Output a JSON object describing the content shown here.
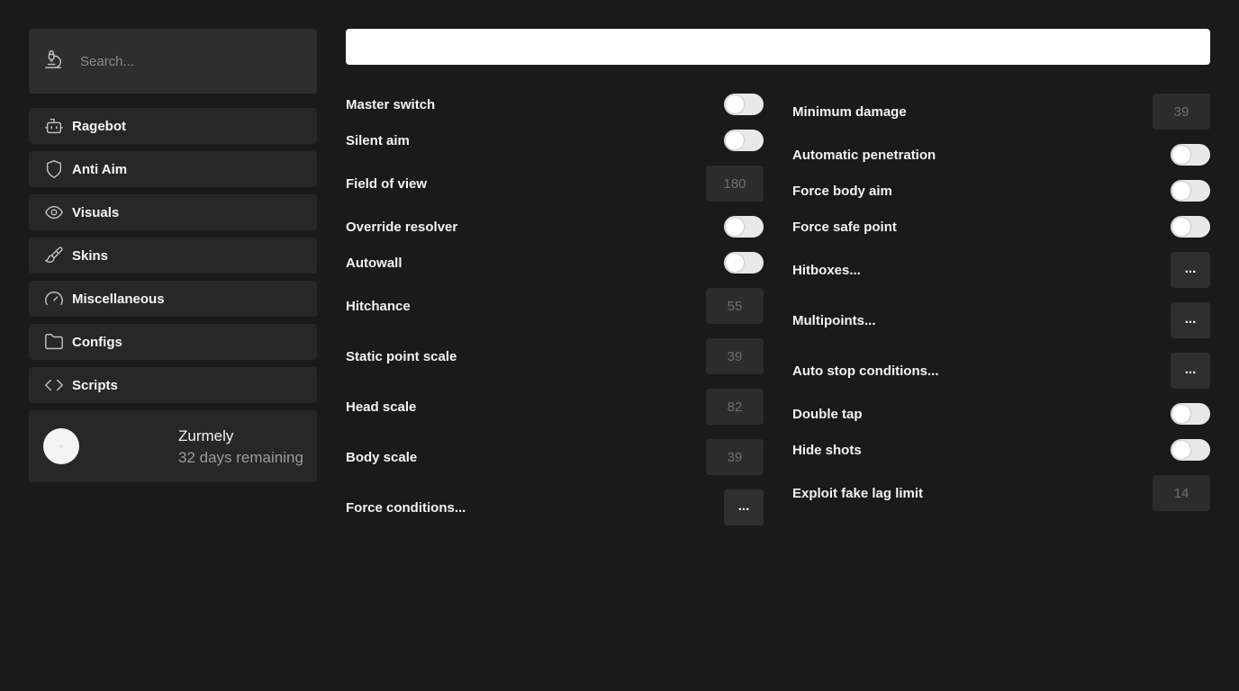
{
  "search": {
    "placeholder": "Search..."
  },
  "sidebar": {
    "items": [
      {
        "label": "Ragebot"
      },
      {
        "label": "Anti Aim"
      },
      {
        "label": "Visuals"
      },
      {
        "label": "Skins"
      },
      {
        "label": "Miscellaneous"
      },
      {
        "label": "Configs"
      },
      {
        "label": "Scripts"
      }
    ]
  },
  "profile": {
    "name": "Zurmely",
    "days": "32 days remaining"
  },
  "left": [
    {
      "label": "Master switch",
      "type": "toggle",
      "on": false
    },
    {
      "label": "Silent aim",
      "type": "toggle",
      "on": false
    },
    {
      "label": "Field of view",
      "type": "number",
      "value": "180"
    },
    {
      "label": "Override resolver",
      "type": "toggle",
      "on": false
    },
    {
      "label": "Autowall",
      "type": "toggle",
      "on": false
    },
    {
      "label": "Hitchance",
      "type": "number",
      "value": "55"
    },
    {
      "label": "Static point scale",
      "type": "number",
      "value": "39"
    },
    {
      "label": "Head scale",
      "type": "number",
      "value": "82"
    },
    {
      "label": "Body scale",
      "type": "number",
      "value": "39"
    },
    {
      "label": "Force conditions...",
      "type": "more",
      "value": "..."
    }
  ],
  "right": [
    {
      "label": "Minimum damage",
      "type": "number",
      "value": "39"
    },
    {
      "label": "Automatic penetration",
      "type": "toggle",
      "on": false
    },
    {
      "label": "Force body aim",
      "type": "toggle",
      "on": false
    },
    {
      "label": "Force safe point",
      "type": "toggle",
      "on": false
    },
    {
      "label": "Hitboxes...",
      "type": "more",
      "value": "..."
    },
    {
      "label": "Multipoints...",
      "type": "more",
      "value": "..."
    },
    {
      "label": "Auto stop conditions...",
      "type": "more",
      "value": "..."
    },
    {
      "label": "Double tap",
      "type": "toggle",
      "on": false
    },
    {
      "label": "Hide shots",
      "type": "toggle",
      "on": false
    },
    {
      "label": "Exploit fake lag limit",
      "type": "number",
      "value": "14"
    }
  ],
  "colors": {
    "background": "#1a1a1a",
    "panel": "#272727",
    "toggle": "#e9e9e9"
  }
}
